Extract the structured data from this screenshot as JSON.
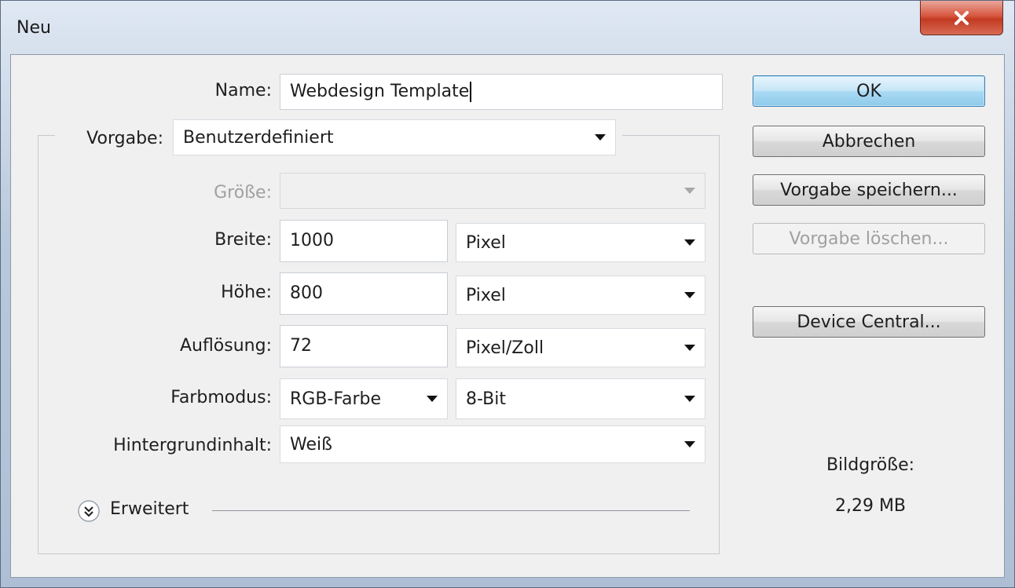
{
  "window": {
    "title": "Neu",
    "close_icon": "close-icon"
  },
  "form": {
    "name_label": "Name:",
    "name_value": "Webdesign Template",
    "vorgabe_label": "Vorgabe:",
    "vorgabe_value": "Benutzerdefiniert",
    "groesse_label": "Größe:",
    "groesse_value": "",
    "breite_label": "Breite:",
    "breite_value": "1000",
    "breite_unit": "Pixel",
    "hoehe_label": "Höhe:",
    "hoehe_value": "800",
    "hoehe_unit": "Pixel",
    "aufloesung_label": "Auflösung:",
    "aufloesung_value": "72",
    "aufloesung_unit": "Pixel/Zoll",
    "farbmodus_label": "Farbmodus:",
    "farbmodus_value": "RGB-Farbe",
    "farbtiefe_value": "8-Bit",
    "hintergrund_label": "Hintergrundinhalt:",
    "hintergrund_value": "Weiß",
    "erweitert_label": "Erweitert"
  },
  "buttons": {
    "ok": "OK",
    "abbrechen": "Abbrechen",
    "vorgabe_speichern": "Vorgabe speichern...",
    "vorgabe_loeschen": "Vorgabe löschen...",
    "device_central": "Device Central..."
  },
  "info": {
    "bildgroesse_label": "Bildgröße:",
    "bildgroesse_value": "2,29 MB"
  }
}
